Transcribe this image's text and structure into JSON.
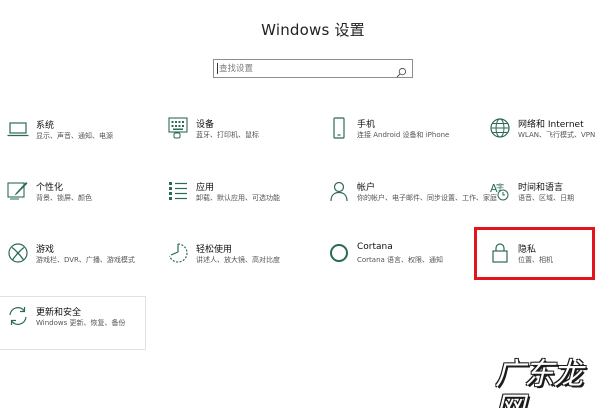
{
  "window": {
    "title": "Windows 设置"
  },
  "search": {
    "placeholder": "查找设置",
    "icon": "search-icon"
  },
  "tiles": [
    {
      "title": "系统",
      "desc": "显示、声音、通知、电源",
      "icon": "laptop-icon"
    },
    {
      "title": "设备",
      "desc": "蓝牙、打印机、鼠标",
      "icon": "keyboard-icon"
    },
    {
      "title": "手机",
      "desc": "连接 Android 设备和 iPhone",
      "icon": "phone-icon"
    },
    {
      "title": "网络和 Internet",
      "desc": "WLAN、飞行模式、VPN",
      "icon": "globe-icon"
    },
    {
      "title": "个性化",
      "desc": "背景、锁屏、颜色",
      "icon": "paintbrush-icon"
    },
    {
      "title": "应用",
      "desc": "卸载、默认应用、可选功能",
      "icon": "apps-list-icon"
    },
    {
      "title": "帐户",
      "desc": "你的帐户、电子邮件、同步设置、工作、家庭",
      "icon": "person-icon"
    },
    {
      "title": "时间和语言",
      "desc": "语音、区域、日期",
      "icon": "time-language-icon"
    },
    {
      "title": "游戏",
      "desc": "游戏栏、DVR、广播、游戏模式",
      "icon": "xbox-icon"
    },
    {
      "title": "轻松使用",
      "desc": "讲述人、放大镜、高对比度",
      "icon": "ease-of-access-icon"
    },
    {
      "title": "Cortana",
      "desc": "Cortana 语言、权限、通知",
      "icon": "cortana-icon"
    },
    {
      "title": "隐私",
      "desc": "位置、相机",
      "icon": "lock-icon"
    },
    {
      "title": "更新和安全",
      "desc": "Windows 更新、恢复、备份",
      "icon": "sync-icon"
    }
  ],
  "watermark": "广东龙网",
  "colors": {
    "icon": "#2b6b54",
    "highlight": "#e3141b",
    "text": "#111111",
    "subtext": "#555555"
  }
}
